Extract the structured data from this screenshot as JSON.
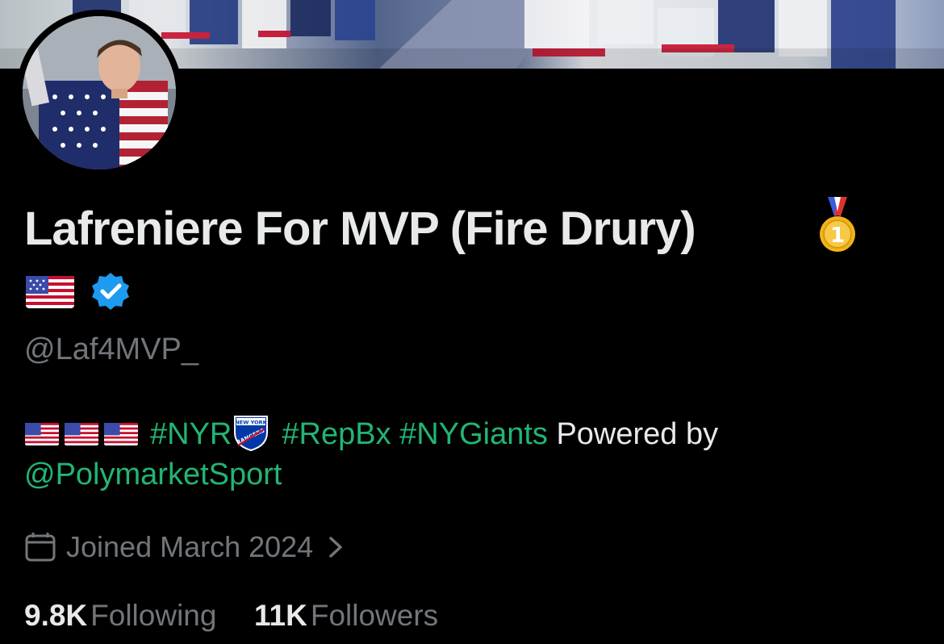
{
  "profile": {
    "display_name": "Lafreniere For MVP (Fire Drury)",
    "name_emoji": "medal-icon",
    "handle": "@Laf4MVP_",
    "verified": true,
    "bio": {
      "flags": [
        "us-flag",
        "us-flag",
        "us-flag"
      ],
      "hashtag_nyr": "#NYR",
      "team_logo_text": "NEW YORK RANGERS",
      "hashtag_repbx": "#RepBx",
      "hashtag_nygiants": "#NYGiants",
      "powered_by": "Powered by",
      "mention": "@PolymarketSport"
    },
    "joined": "Joined March 2024",
    "following_count": "9.8K",
    "following_label": "Following",
    "followers_count": "11K",
    "followers_label": "Followers"
  },
  "colors": {
    "background": "#000000",
    "text_primary": "#e7e9ea",
    "text_secondary": "#71767b",
    "link_accent": "#22b573",
    "verified_blue": "#1d9bf0"
  }
}
